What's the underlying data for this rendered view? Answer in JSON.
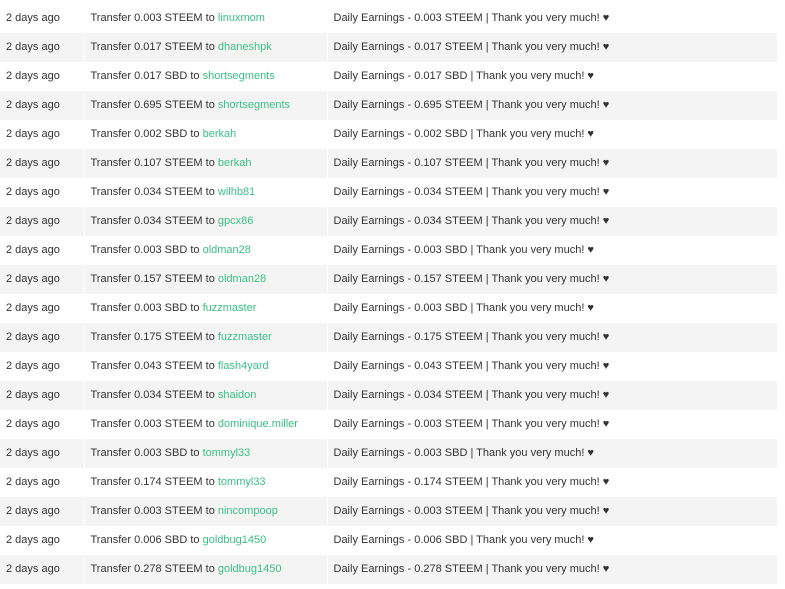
{
  "transfers": [
    {
      "time": "2 days ago",
      "prefix": "Transfer 0.003 STEEM to ",
      "user": "linuxmom",
      "memo": "Daily Earnings - 0.003 STEEM | Thank you very much! ♥"
    },
    {
      "time": "2 days ago",
      "prefix": "Transfer 0.017 STEEM to ",
      "user": "dhaneshpk",
      "memo": "Daily Earnings - 0.017 STEEM | Thank you very much! ♥"
    },
    {
      "time": "2 days ago",
      "prefix": "Transfer 0.017 SBD to ",
      "user": "shortsegments",
      "memo": "Daily Earnings - 0.017 SBD | Thank you very much! ♥"
    },
    {
      "time": "2 days ago",
      "prefix": "Transfer 0.695 STEEM to ",
      "user": "shortsegments",
      "memo": "Daily Earnings - 0.695 STEEM | Thank you very much! ♥"
    },
    {
      "time": "2 days ago",
      "prefix": "Transfer 0.002 SBD to ",
      "user": "berkah",
      "memo": "Daily Earnings - 0.002 SBD | Thank you very much! ♥"
    },
    {
      "time": "2 days ago",
      "prefix": "Transfer 0.107 STEEM to ",
      "user": "berkah",
      "memo": "Daily Earnings - 0.107 STEEM | Thank you very much! ♥"
    },
    {
      "time": "2 days ago",
      "prefix": "Transfer 0.034 STEEM to ",
      "user": "wilhb81",
      "memo": "Daily Earnings - 0.034 STEEM | Thank you very much! ♥"
    },
    {
      "time": "2 days ago",
      "prefix": "Transfer 0.034 STEEM to ",
      "user": "gpcx86",
      "memo": "Daily Earnings - 0.034 STEEM | Thank you very much! ♥"
    },
    {
      "time": "2 days ago",
      "prefix": "Transfer 0.003 SBD to ",
      "user": "oldman28",
      "memo": "Daily Earnings - 0.003 SBD | Thank you very much! ♥"
    },
    {
      "time": "2 days ago",
      "prefix": "Transfer 0.157 STEEM to ",
      "user": "oldman28",
      "memo": "Daily Earnings - 0.157 STEEM | Thank you very much! ♥"
    },
    {
      "time": "2 days ago",
      "prefix": "Transfer 0.003 SBD to ",
      "user": "fuzzmaster",
      "memo": "Daily Earnings - 0.003 SBD | Thank you very much! ♥"
    },
    {
      "time": "2 days ago",
      "prefix": "Transfer 0.175 STEEM to ",
      "user": "fuzzmaster",
      "memo": "Daily Earnings - 0.175 STEEM | Thank you very much! ♥"
    },
    {
      "time": "2 days ago",
      "prefix": "Transfer 0.043 STEEM to ",
      "user": "flash4yard",
      "memo": "Daily Earnings - 0.043 STEEM | Thank you very much! ♥"
    },
    {
      "time": "2 days ago",
      "prefix": "Transfer 0.034 STEEM to ",
      "user": "shaidon",
      "memo": "Daily Earnings - 0.034 STEEM | Thank you very much! ♥"
    },
    {
      "time": "2 days ago",
      "prefix": "Transfer 0.003 STEEM to ",
      "user": "dominique.miller",
      "memo": "Daily Earnings - 0.003 STEEM | Thank you very much! ♥"
    },
    {
      "time": "2 days ago",
      "prefix": "Transfer 0.003 SBD to ",
      "user": "tommyl33",
      "memo": "Daily Earnings - 0.003 SBD | Thank you very much! ♥"
    },
    {
      "time": "2 days ago",
      "prefix": "Transfer 0.174 STEEM to ",
      "user": "tommyl33",
      "memo": "Daily Earnings - 0.174 STEEM | Thank you very much! ♥"
    },
    {
      "time": "2 days ago",
      "prefix": "Transfer 0.003 STEEM to ",
      "user": "nincompoop",
      "memo": "Daily Earnings - 0.003 STEEM | Thank you very much! ♥"
    },
    {
      "time": "2 days ago",
      "prefix": "Transfer 0.006 SBD to ",
      "user": "goldbug1450",
      "memo": "Daily Earnings - 0.006 SBD | Thank you very much! ♥"
    },
    {
      "time": "2 days ago",
      "prefix": "Transfer 0.278 STEEM to ",
      "user": "goldbug1450",
      "memo": "Daily Earnings - 0.278 STEEM | Thank you very much! ♥"
    }
  ],
  "colors": {
    "user_link": "#3abf85",
    "row_alt": "#f4f4f4",
    "text": "#333333"
  }
}
